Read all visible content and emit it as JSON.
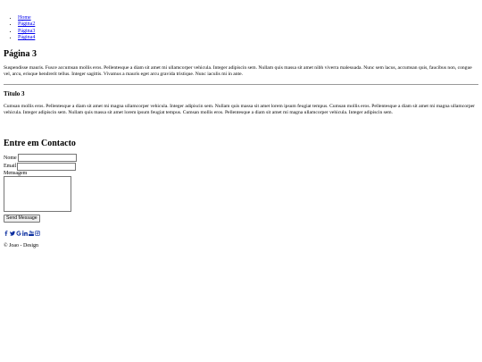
{
  "nav": {
    "items": [
      {
        "label": "Home"
      },
      {
        "label": "Página2"
      },
      {
        "label": "Página3"
      },
      {
        "label": "Página4"
      }
    ]
  },
  "page": {
    "title": "Página 3",
    "intro": "Suspendisse mauris. Fusce accumsan mollis eros. Pellentesque a diam sit amet mi ullamcorper vehicula. Integer adipiscin sem. Nullam quis massa sit amet nibh viverra malesuada. Nunc sem lacus, accumsan quis, faucibus non, congue vel, arcu, erisque hendrerit tellus. Integer sagittis. Vivamus a mauris eget arcu gravida tristique. Nunc iaculis mi in ante.",
    "section_title": "Título 3",
    "section_text": "Cumsan mollis eros. Pellentesque a diam sit amet mi magna ullamcorper vehicula. Integer adipiscin sem. Nullam quis massa sit amet lorem ipsum feugiat tempus. Cumsan mollis eros. Pellentesque a diam sit amet mi magna ullamcorper vehicula. Integer adipiscin sem. Nullam quis massa sit amet lorem ipsum feugiat tempus. Cumsan mollis eros. Pellentesque a diam sit amet mi magna ullamcorper vehicula. Integer adipiscin sem."
  },
  "contact": {
    "title": "Entre em Contacto",
    "name_label": "Nome",
    "email_label": "Email",
    "message_label": "Mensagem",
    "name_value": "",
    "email_value": "",
    "send_label": "Send Message"
  },
  "social": {
    "icons": [
      "facebook-icon",
      "twitter-icon",
      "google-icon",
      "linkedin-icon",
      "youtube-icon",
      "instagram-icon"
    ]
  },
  "footer": {
    "text": "© Joao - Design"
  }
}
